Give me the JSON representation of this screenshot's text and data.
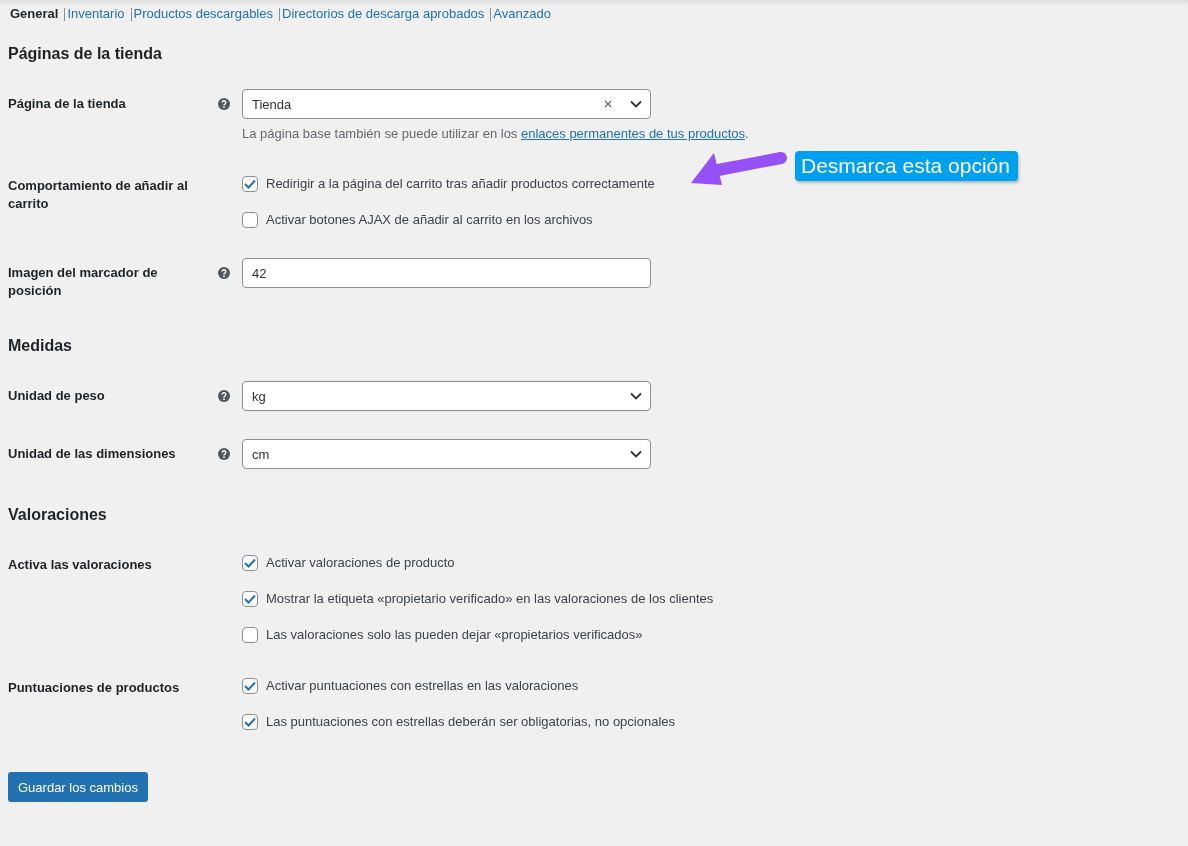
{
  "tabs": [
    {
      "label": "General",
      "selected": true
    },
    {
      "label": "Inventario",
      "selected": false
    },
    {
      "label": "Productos descargables",
      "selected": false
    },
    {
      "label": "Directorios de descarga aprobados",
      "selected": false
    },
    {
      "label": "Avanzado",
      "selected": false
    }
  ],
  "sections": [
    {
      "title": "Páginas de la tienda",
      "rows": [
        {
          "kind": "select",
          "label": "Página de la tienda",
          "help": true,
          "value": "Tienda",
          "clearable": true,
          "description": {
            "text": "La página base también se puede utilizar en los ",
            "link": "enlaces permanentes de tus productos",
            "suffix": "."
          }
        },
        {
          "kind": "checkboxes",
          "label": "Comportamiento de añadir al carrito",
          "help": false,
          "options": [
            {
              "label": "Redirigir a la página del carrito tras añadir productos correctamente",
              "checked": true
            },
            {
              "label": "Activar botones AJAX de añadir al carrito en los archivos",
              "checked": false
            }
          ]
        },
        {
          "kind": "input",
          "label": "Imagen del marcador de posición",
          "help": true,
          "value": "42"
        }
      ]
    },
    {
      "title": "Medidas",
      "rows": [
        {
          "kind": "select",
          "label": "Unidad de peso",
          "help": true,
          "value": "kg",
          "clearable": false
        },
        {
          "kind": "select",
          "label": "Unidad de las dimensiones",
          "help": true,
          "value": "cm",
          "clearable": false
        }
      ]
    },
    {
      "title": "Valoraciones",
      "rows": [
        {
          "kind": "checkboxes",
          "label": "Activa las valoraciones",
          "help": false,
          "options": [
            {
              "label": "Activar valoraciones de producto",
              "checked": true
            },
            {
              "label": "Mostrar la etiqueta «propietario verificado» en las valoraciones de los clientes",
              "checked": true
            },
            {
              "label": "Las valoraciones solo las pueden dejar «propietarios verificados»",
              "checked": false
            }
          ]
        },
        {
          "kind": "checkboxes",
          "label": "Puntuaciones de productos",
          "help": false,
          "options": [
            {
              "label": "Activar puntuaciones con estrellas en las valoraciones",
              "checked": true
            },
            {
              "label": "Las puntuaciones con estrellas deberán ser obligatorias, no opcionales",
              "checked": true
            }
          ]
        }
      ]
    }
  ],
  "annotation": {
    "text": "Desmarca esta opción"
  },
  "save_button": "Guardar los cambios"
}
